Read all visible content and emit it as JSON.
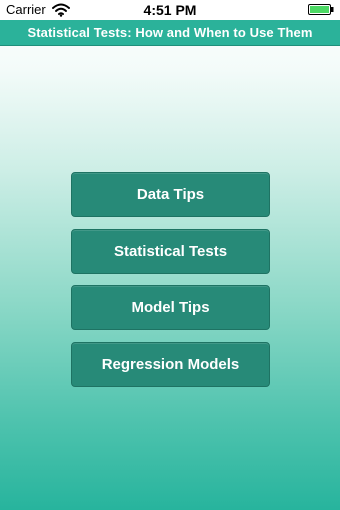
{
  "status_bar": {
    "carrier": "Carrier",
    "time": "4:51 PM",
    "wifi_icon": "wifi-icon",
    "battery_icon": "battery-icon"
  },
  "title_bar": {
    "title": "Statistical Tests: How and When to Use Them"
  },
  "menu": {
    "items": [
      {
        "label": "Data Tips"
      },
      {
        "label": "Statistical Tests"
      },
      {
        "label": "Model Tips"
      },
      {
        "label": "Regression Models"
      }
    ]
  },
  "colors": {
    "title_bar": "#2bb29a",
    "button": "#278a78",
    "button_text": "#ffffff",
    "battery_fill": "#4cd964"
  }
}
